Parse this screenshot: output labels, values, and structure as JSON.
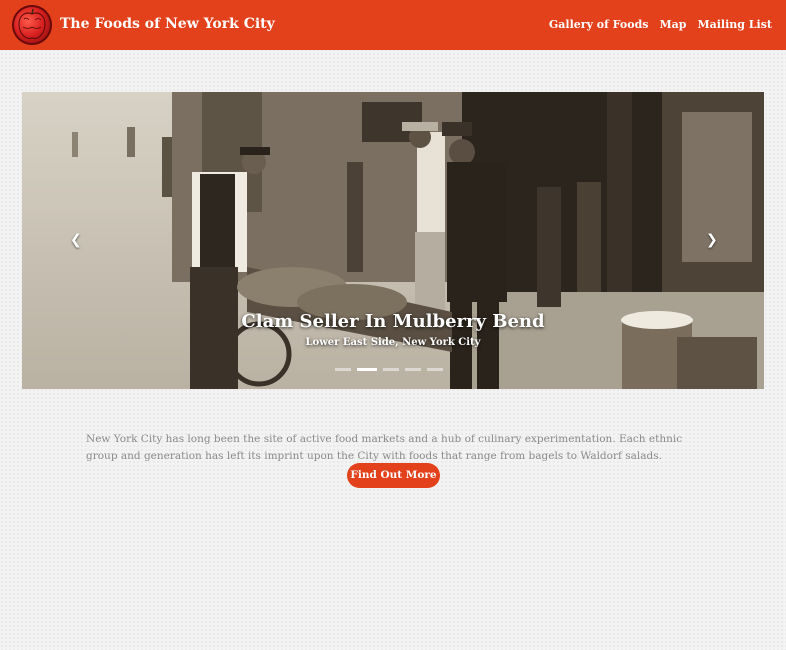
{
  "header": {
    "brand": "The Foods of New York City",
    "logo_icon": "apple-logo-icon",
    "nav": [
      {
        "label": "Gallery of Foods"
      },
      {
        "label": "Map"
      },
      {
        "label": "Mailing List"
      }
    ],
    "accent_color": "#e2411c"
  },
  "carousel": {
    "caption_title": "Clam Seller In Mulberry Bend",
    "caption_subtitle": "Lower East Side, New York City",
    "prev_icon": "chevron-left-icon",
    "next_icon": "chevron-right-icon",
    "slide_count": 5,
    "active_index": 1
  },
  "intro": {
    "text": "New York City has long been the site of active food markets and a hub of culinary experimentation. Each ethnic group and generation has left its imprint upon the City with foods that range from bagels to Waldorf salads.",
    "button_label": "Find Out More"
  }
}
